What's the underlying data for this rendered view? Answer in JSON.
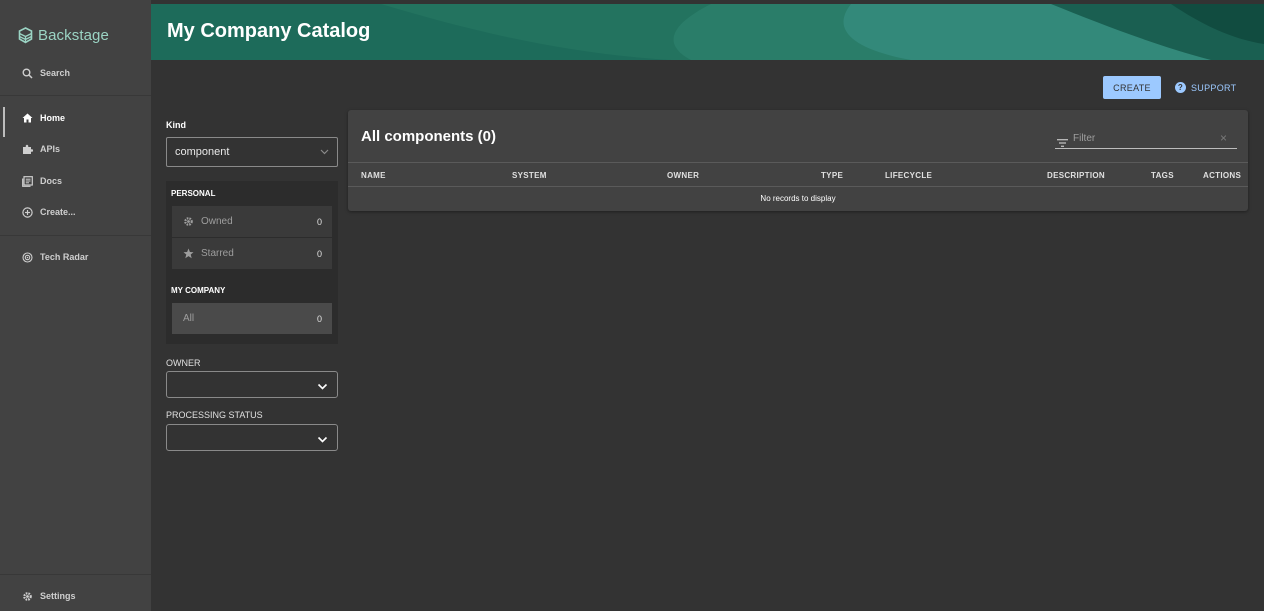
{
  "app": {
    "name": "Backstage",
    "accent_color": "#9bd4c4",
    "header_color": "#1f6d5c"
  },
  "sidebar": {
    "search": {
      "label": "Search",
      "icon": "search-icon"
    },
    "items": [
      {
        "label": "Home",
        "icon": "home-icon",
        "active": true
      },
      {
        "label": "APIs",
        "icon": "puzzle-icon",
        "active": false
      },
      {
        "label": "Docs",
        "icon": "docs-icon",
        "active": false
      },
      {
        "label": "Create...",
        "icon": "add-circle-icon",
        "active": false
      }
    ],
    "tech_radar": {
      "label": "Tech Radar",
      "icon": "radar-icon"
    },
    "settings": {
      "label": "Settings",
      "icon": "gear-icon"
    }
  },
  "header": {
    "title": "My Company Catalog"
  },
  "actions": {
    "create_label": "CREATE",
    "support_label": "SUPPORT",
    "create_color": "#9cc9ff"
  },
  "filters": {
    "kind_label": "Kind",
    "kind_value": "component",
    "personal_label": "PERSONAL",
    "owned_label": "Owned",
    "owned_count": "0",
    "starred_label": "Starred",
    "starred_count": "0",
    "company_label": "MY COMPANY",
    "all_label": "All",
    "all_count": "0",
    "owner_label": "OWNER",
    "processing_label": "PROCESSING STATUS"
  },
  "table": {
    "title": "All components (0)",
    "filter_placeholder": "Filter",
    "columns": [
      "NAME",
      "SYSTEM",
      "OWNER",
      "TYPE",
      "LIFECYCLE",
      "DESCRIPTION",
      "TAGS",
      "ACTIONS"
    ],
    "empty_message": "No records to display"
  }
}
